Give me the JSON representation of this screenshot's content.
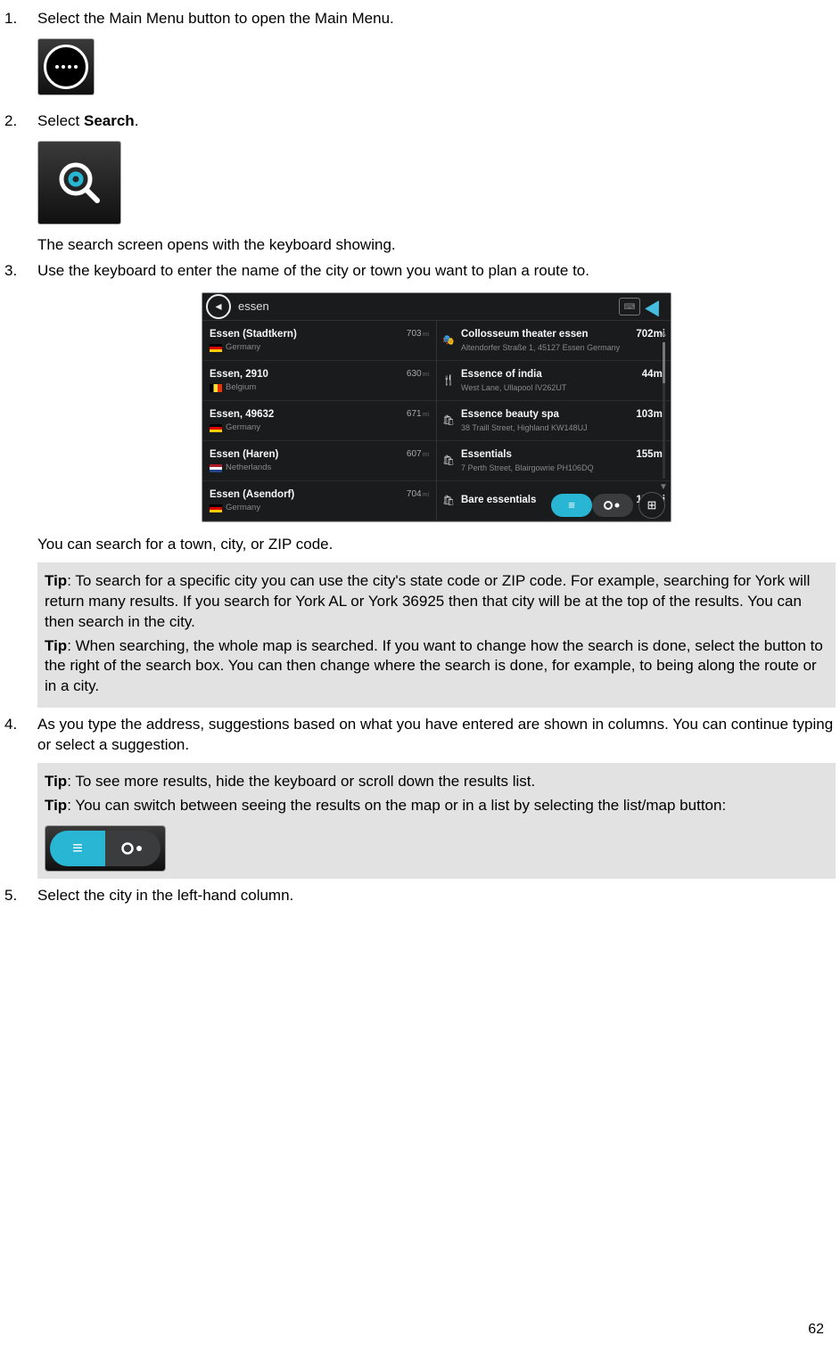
{
  "steps": {
    "s1": {
      "num": "1.",
      "text": "Select the Main Menu button to open the Main Menu."
    },
    "s2": {
      "num": "2.",
      "text_before": "Select ",
      "bold": "Search",
      "text_after": ".",
      "after_icon": "The search screen opens with the keyboard showing."
    },
    "s3": {
      "num": "3.",
      "text": "Use the keyboard to enter the name of the city or town you want to plan a route to.",
      "after_shot": "You can search for a town, city, or ZIP code."
    },
    "s4": {
      "num": "4.",
      "text": "As you type the address, suggestions based on what you have entered are shown in columns. You can continue typing or select a suggestion."
    },
    "s5": {
      "num": "5.",
      "text": "Select the city in the left-hand column."
    }
  },
  "tips": {
    "box1": {
      "p1_bold": "Tip",
      "p1": ": To search for a specific city you can use the city's state code or ZIP code. For example, searching for York will return many results. If you search for York AL or York 36925 then that city will be at the top of the results. You can then search in the city.",
      "p2_bold": "Tip",
      "p2": ": When searching, the whole map is searched. If you want to change how the search is done, select the button to the right of the search box. You can then change where the search is done, for example, to being along the route or in a city."
    },
    "box2": {
      "p1_bold": "Tip",
      "p1": ": To see more results, hide the keyboard or scroll down the results list.",
      "p2_bold": "Tip",
      "p2": ": You can switch between seeing the results on the map or in a list by selecting the list/map button:"
    }
  },
  "screenshot": {
    "query": "essen",
    "left": [
      {
        "title": "Essen (Stadtkern)",
        "dist": "703",
        "unit": "mi",
        "country": "Germany",
        "flag": "de"
      },
      {
        "title": "Essen, 2910",
        "dist": "630",
        "unit": "mi",
        "country": "Belgium",
        "flag": "be"
      },
      {
        "title": "Essen, 49632",
        "dist": "671",
        "unit": "mi",
        "country": "Germany",
        "flag": "de"
      },
      {
        "title": "Essen (Haren)",
        "dist": "607",
        "unit": "mi",
        "country": "Netherlands",
        "flag": "nl"
      },
      {
        "title": "Essen (Asendorf)",
        "dist": "704",
        "unit": "mi",
        "country": "Germany",
        "flag": "de"
      }
    ],
    "right": [
      {
        "icon": "🎭",
        "title": "Collosseum theater essen",
        "dist": "702",
        "unit": "mi",
        "sub": "Altendorfer Straße 1, 45127 Essen Germany"
      },
      {
        "icon": "🍴",
        "title": "Essence of india",
        "dist": "44",
        "unit": "mi",
        "sub": "West Lane, Ullapool IV262UT"
      },
      {
        "icon": "🛍",
        "title": "Essence beauty spa",
        "dist": "103",
        "unit": "mi",
        "sub": "38 Traill Street, Highland KW148UJ"
      },
      {
        "icon": "🛍",
        "title": "Essentials",
        "dist": "155",
        "unit": "mi",
        "sub": "7 Perth Street, Blairgowrie PH106DQ"
      },
      {
        "icon": "🛍",
        "title": "Bare essentials",
        "dist": "155",
        "unit": "mi",
        "sub": ""
      }
    ]
  },
  "page_number": "62"
}
